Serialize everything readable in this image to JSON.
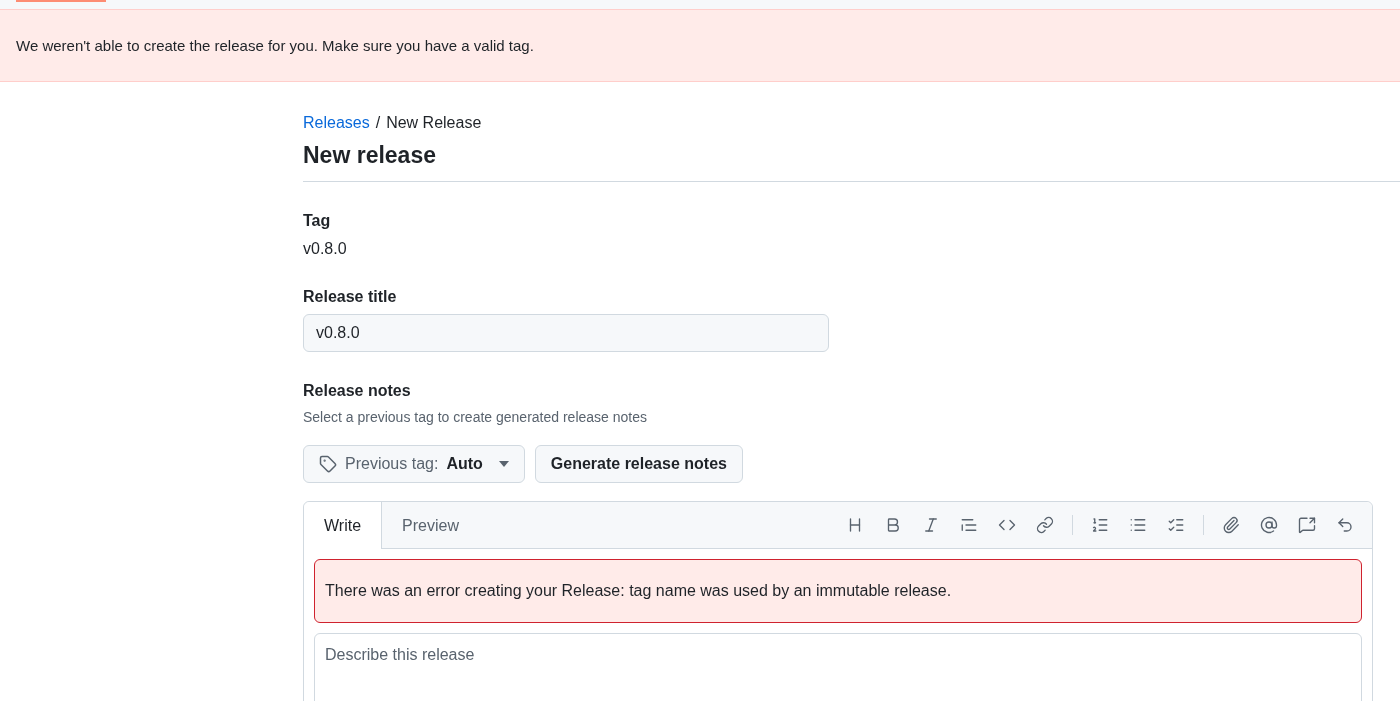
{
  "flash_error": "We weren't able to create the release for you. Make sure you have a valid tag.",
  "breadcrumb": {
    "link": "Releases",
    "separator": "/",
    "current": "New Release"
  },
  "heading": "New release",
  "tag": {
    "label": "Tag",
    "value": "v0.8.0"
  },
  "release_title": {
    "label": "Release title",
    "value": "v0.8.0"
  },
  "release_notes": {
    "label": "Release notes",
    "hint": "Select a previous tag to create generated release notes"
  },
  "previous_tag_button": {
    "label": "Previous tag:",
    "value": "Auto"
  },
  "generate_button": "Generate release notes",
  "editor_tabs": [
    {
      "label": "Write",
      "selected": true
    },
    {
      "label": "Preview",
      "selected": false
    }
  ],
  "editor_error": "There was an error creating your Release: tag name was used by an immutable release.",
  "description": {
    "placeholder": "Describe this release"
  }
}
